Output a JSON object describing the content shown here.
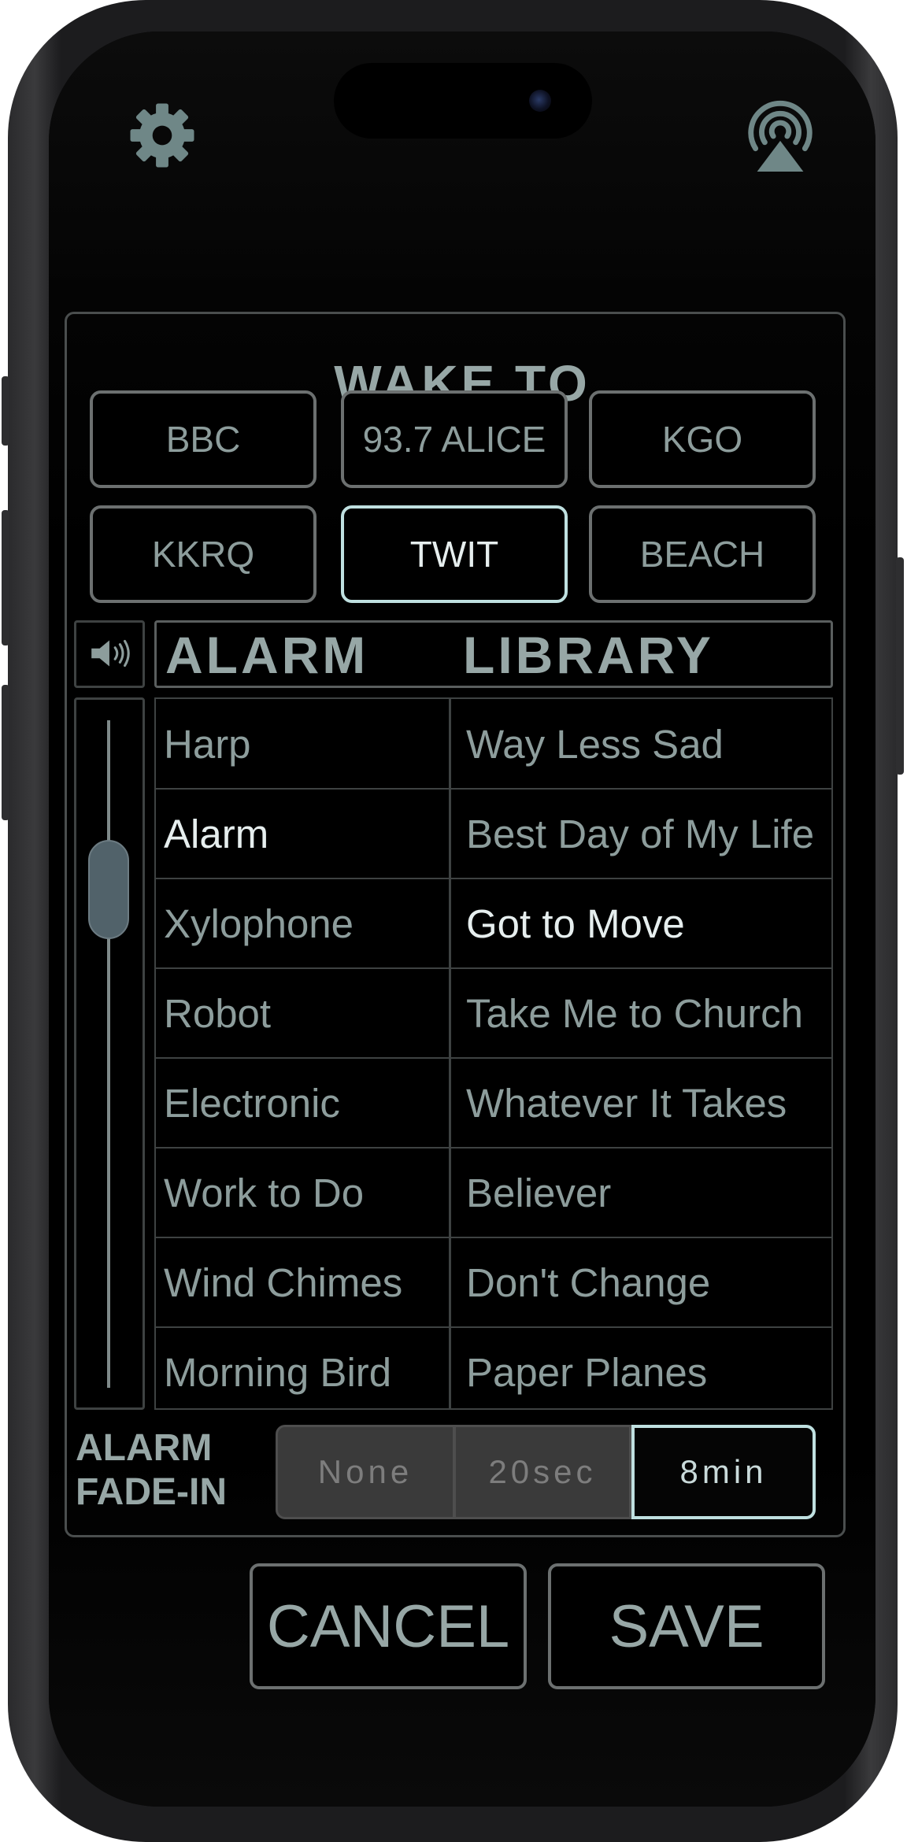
{
  "header": {
    "settings_icon": "gear-icon",
    "airplay_icon": "airplay-icon"
  },
  "wake_to": {
    "title": "WAKE TO",
    "stations": [
      {
        "label": "BBC",
        "selected": false
      },
      {
        "label": "93.7 ALICE",
        "selected": false
      },
      {
        "label": "KGO",
        "selected": false
      },
      {
        "label": "KKRQ",
        "selected": false
      },
      {
        "label": "TWIT",
        "selected": true
      },
      {
        "label": "BEACH",
        "selected": false
      }
    ]
  },
  "volume": {
    "icon": "speaker-icon",
    "level": 0.75
  },
  "alarm": {
    "title": "ALARM",
    "items": [
      "Harp",
      "Alarm",
      "Xylophone",
      "Robot",
      "Electronic",
      "Work to Do",
      "Wind Chimes",
      "Morning Bird"
    ],
    "selected_index": 1
  },
  "library": {
    "title": "LIBRARY",
    "items": [
      "Way Less Sad",
      "Best Day of My Life",
      "Got to Move",
      "Take Me to Church",
      "Whatever It Takes",
      "Believer",
      "Don't Change",
      "Paper Planes"
    ],
    "selected_index": 2
  },
  "fade_in": {
    "label_line1": "ALARM",
    "label_line2": "FADE-IN",
    "options": [
      "None",
      "20sec",
      "8min"
    ],
    "selected_index": 2
  },
  "actions": {
    "cancel_label": "CANCEL",
    "save_label": "SAVE"
  },
  "colors": {
    "accent": "#bfe0e0",
    "text": "#8d9d9c",
    "text_selected": "#e6eeee",
    "background": "#000000"
  }
}
